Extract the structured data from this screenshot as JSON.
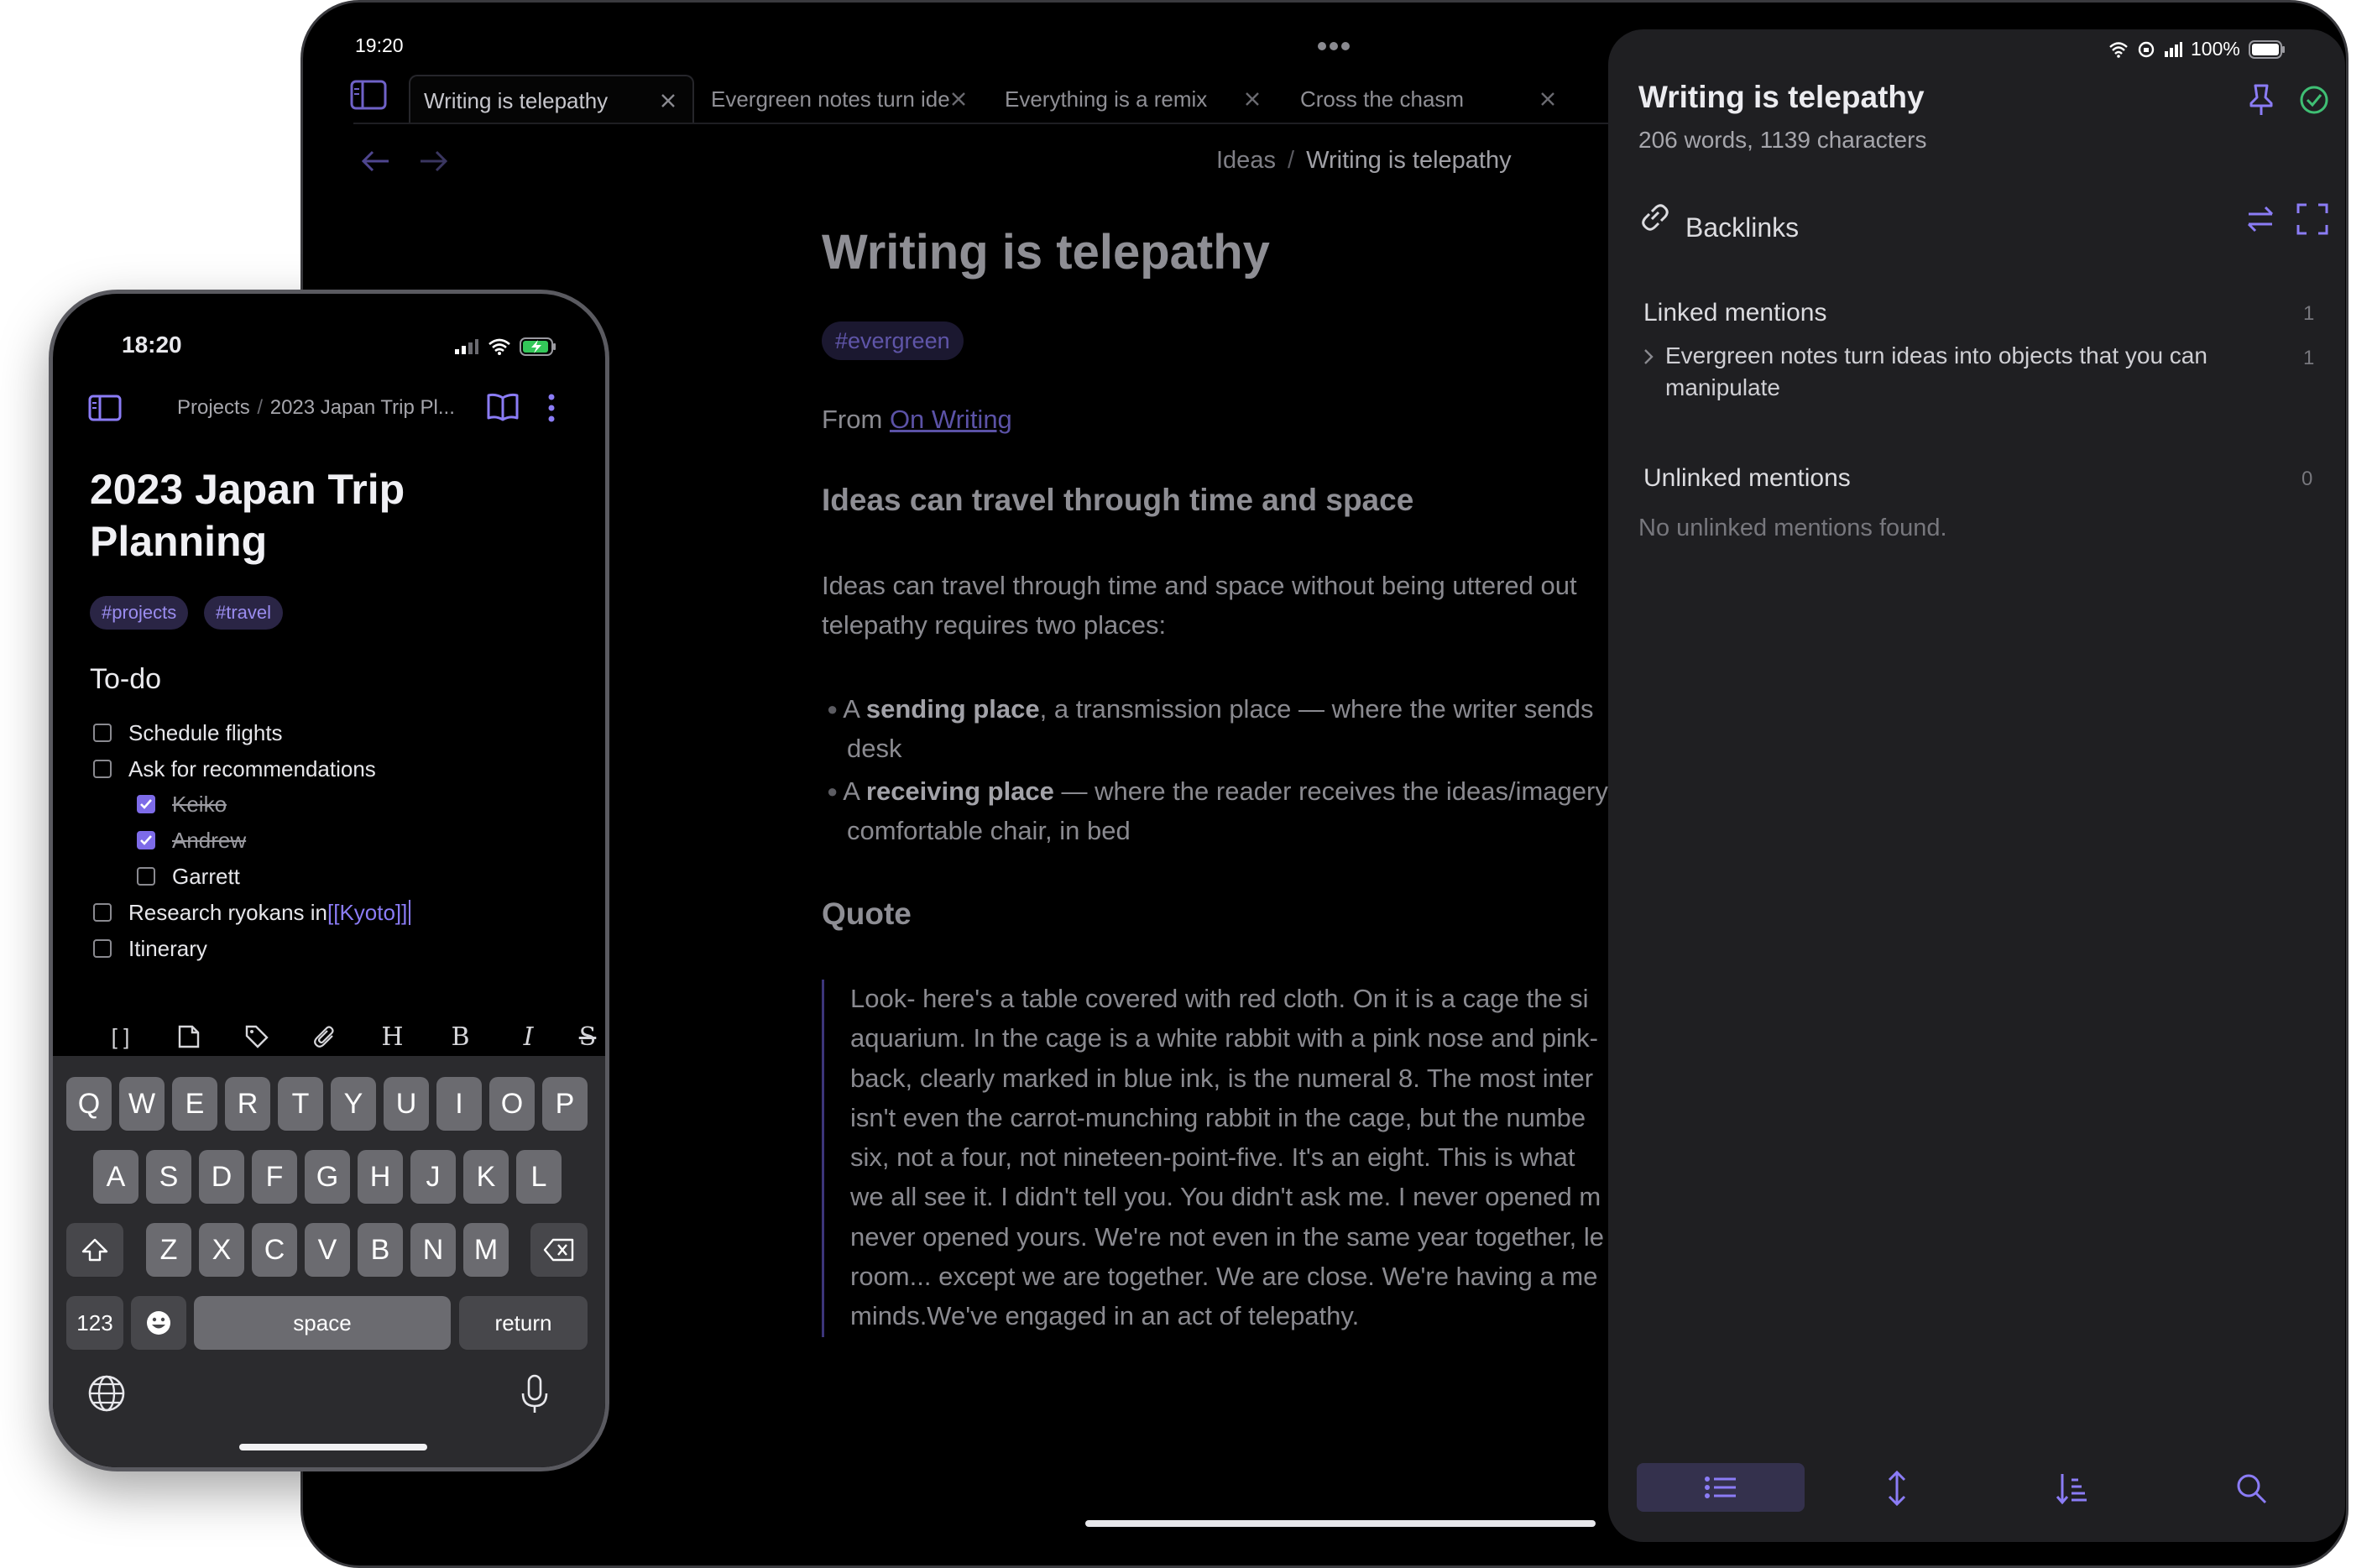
{
  "colors": {
    "accent": "#8b7cf6",
    "tablet_bg": "#000000",
    "panel_bg": "#1f1f22",
    "phone_bg": "#000000"
  },
  "tablet": {
    "status": {
      "time": "19:20",
      "battery": "100%"
    },
    "tabs": [
      {
        "label": "Writing is telepathy",
        "active": true
      },
      {
        "label": "Evergreen notes turn ideas into objects",
        "active": false
      },
      {
        "label": "Everything is a remix",
        "active": false
      },
      {
        "label": "Cross the chasm",
        "active": false
      }
    ],
    "breadcrumb": {
      "folder": "Ideas",
      "separator": "/",
      "note": "Writing is telepathy"
    },
    "note": {
      "title": "Writing is telepathy",
      "tag": "#evergreen",
      "from_prefix": "From ",
      "from_link": "On Writing",
      "heading1": "Ideas can travel through time and space",
      "para1_line1": "Ideas can travel through time and space without being uttered out",
      "para1_line2": "telepathy requires two places:",
      "bullets": [
        {
          "pre": "A ",
          "bold": "sending place",
          "post": ", a transmission place — where the writer sends",
          "cont": "desk"
        },
        {
          "pre": "A ",
          "bold": "receiving place",
          "post": " — where the reader receives the ideas/imagery",
          "cont": "comfortable chair, in bed"
        }
      ],
      "heading2": "Quote",
      "quote_lines": [
        "Look- here's a table covered with red cloth. On it is a cage the si",
        "aquarium. In the cage is a white rabbit with a pink nose and pink-",
        "back, clearly marked in blue ink, is the numeral 8. The most inter",
        "isn't even the carrot-munching rabbit in the cage, but the numbe",
        "six, not a four, not nineteen-point-five. It's an eight. This is what",
        "we all see it. I didn't tell you. You didn't ask me. I never opened m",
        "never opened yours. We're not even in the same year together, le",
        "room... except we are together. We are close. We're having a me",
        "minds.We've engaged in an act of telepathy."
      ]
    },
    "panel": {
      "title": "Writing is telepathy",
      "stats": "206 words, 1139 characters",
      "section": "Backlinks",
      "linked_label": "Linked mentions",
      "linked_count": "1",
      "linked_item_line1": "Evergreen notes turn ideas into objects that you can",
      "linked_item_line2": "manipulate",
      "linked_item_count": "1",
      "unlinked_label": "Unlinked mentions",
      "unlinked_count": "0",
      "unlinked_empty": "No unlinked mentions found."
    }
  },
  "phone": {
    "status": {
      "time": "18:20"
    },
    "breadcrumb": {
      "folder": "Projects",
      "separator": "/",
      "note": "2023 Japan Trip Pl..."
    },
    "title_line1": "2023 Japan Trip",
    "title_line2": "Planning",
    "tags": [
      "#projects",
      "#travel"
    ],
    "section": "To-do",
    "todos": [
      {
        "label": "Schedule flights",
        "checked": false,
        "indent": 0
      },
      {
        "label": "Ask for recommendations",
        "checked": false,
        "indent": 0
      },
      {
        "label": "Keiko",
        "checked": true,
        "indent": 1
      },
      {
        "label": "Andrew",
        "checked": true,
        "indent": 1
      },
      {
        "label": "Garrett",
        "checked": false,
        "indent": 1
      },
      {
        "label": "Research ryokans in ",
        "link": "[[Kyoto]]",
        "checked": false,
        "indent": 0
      },
      {
        "label": "Itinerary",
        "checked": false,
        "indent": 0
      }
    ],
    "toolbar_icons": [
      "brackets-icon",
      "note-icon",
      "tag-icon",
      "attachment-icon",
      "heading-icon",
      "bold-icon",
      "italic-icon",
      "strikethrough-icon"
    ],
    "toolbar_glyphs": [
      "[ ]",
      "",
      "",
      "",
      "H",
      "B",
      "I",
      "S"
    ],
    "keyboard": {
      "row1": [
        "Q",
        "W",
        "E",
        "R",
        "T",
        "Y",
        "U",
        "I",
        "O",
        "P"
      ],
      "row2": [
        "A",
        "S",
        "D",
        "F",
        "G",
        "H",
        "J",
        "K",
        "L"
      ],
      "row3": [
        "Z",
        "X",
        "C",
        "V",
        "B",
        "N",
        "M"
      ],
      "numbers": "123",
      "space": "space",
      "return": "return"
    }
  }
}
